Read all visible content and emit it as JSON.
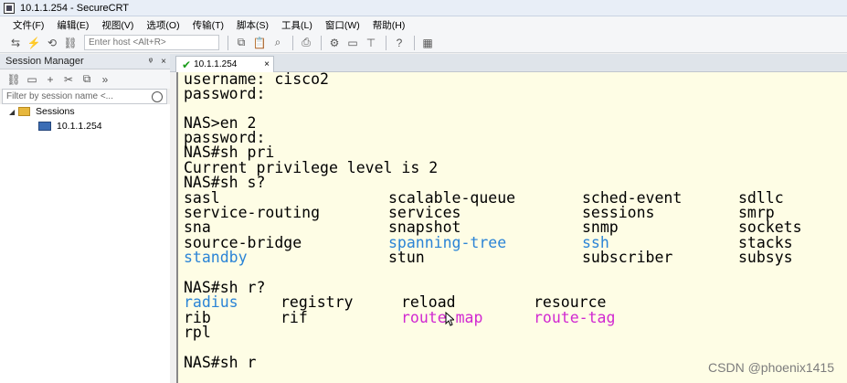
{
  "window": {
    "title": "10.1.1.254 - SecureCRT"
  },
  "menu": [
    "文件(F)",
    "编辑(E)",
    "视图(V)",
    "选项(O)",
    "传输(T)",
    "脚本(S)",
    "工具(L)",
    "窗口(W)",
    "帮助(H)"
  ],
  "toolbar": {
    "host_placeholder": "Enter host <Alt+R>"
  },
  "session_manager": {
    "title": "Session Manager",
    "pin": "ᵠ",
    "close": "×",
    "filter_placeholder": "Filter by session name <...",
    "tree": [
      {
        "label": "Sessions",
        "type": "folder"
      },
      {
        "label": "10.1.1.254",
        "type": "session"
      }
    ]
  },
  "tab": {
    "label": "10.1.1.254",
    "close": "×"
  },
  "terminal": {
    "l1": "username: cisco2",
    "l2": "password:",
    "l4": "NAS>en 2",
    "l5": "password:",
    "l6": "NAS#sh pri",
    "l7": "Current privilege level is 2",
    "l8": "NAS#sh s?",
    "row9": [
      "sasl",
      "scalable-queue",
      "sched-event",
      "sdllc"
    ],
    "row10": [
      "service-routing",
      "services",
      "sessions",
      "smrp"
    ],
    "row11": [
      "sna",
      "snapshot",
      "snmp",
      "sockets"
    ],
    "row12": [
      "source-bridge",
      "spanning-tree",
      "ssh",
      "stacks"
    ],
    "row13": [
      "standby",
      "stun",
      "subscriber",
      "subsys"
    ],
    "l15": "NAS#sh r?",
    "row16": [
      "radius",
      "registry",
      "reload",
      "resource"
    ],
    "row17": [
      "rib",
      "rif",
      "route-map",
      "route-tag"
    ],
    "row18": [
      "rpl"
    ],
    "l20": "NAS#sh r",
    "colors": {
      "keyword": "#2b84d6",
      "highlight": "#d128d1",
      "background": "#fefde5"
    }
  },
  "watermark": "CSDN @phoenix1415"
}
